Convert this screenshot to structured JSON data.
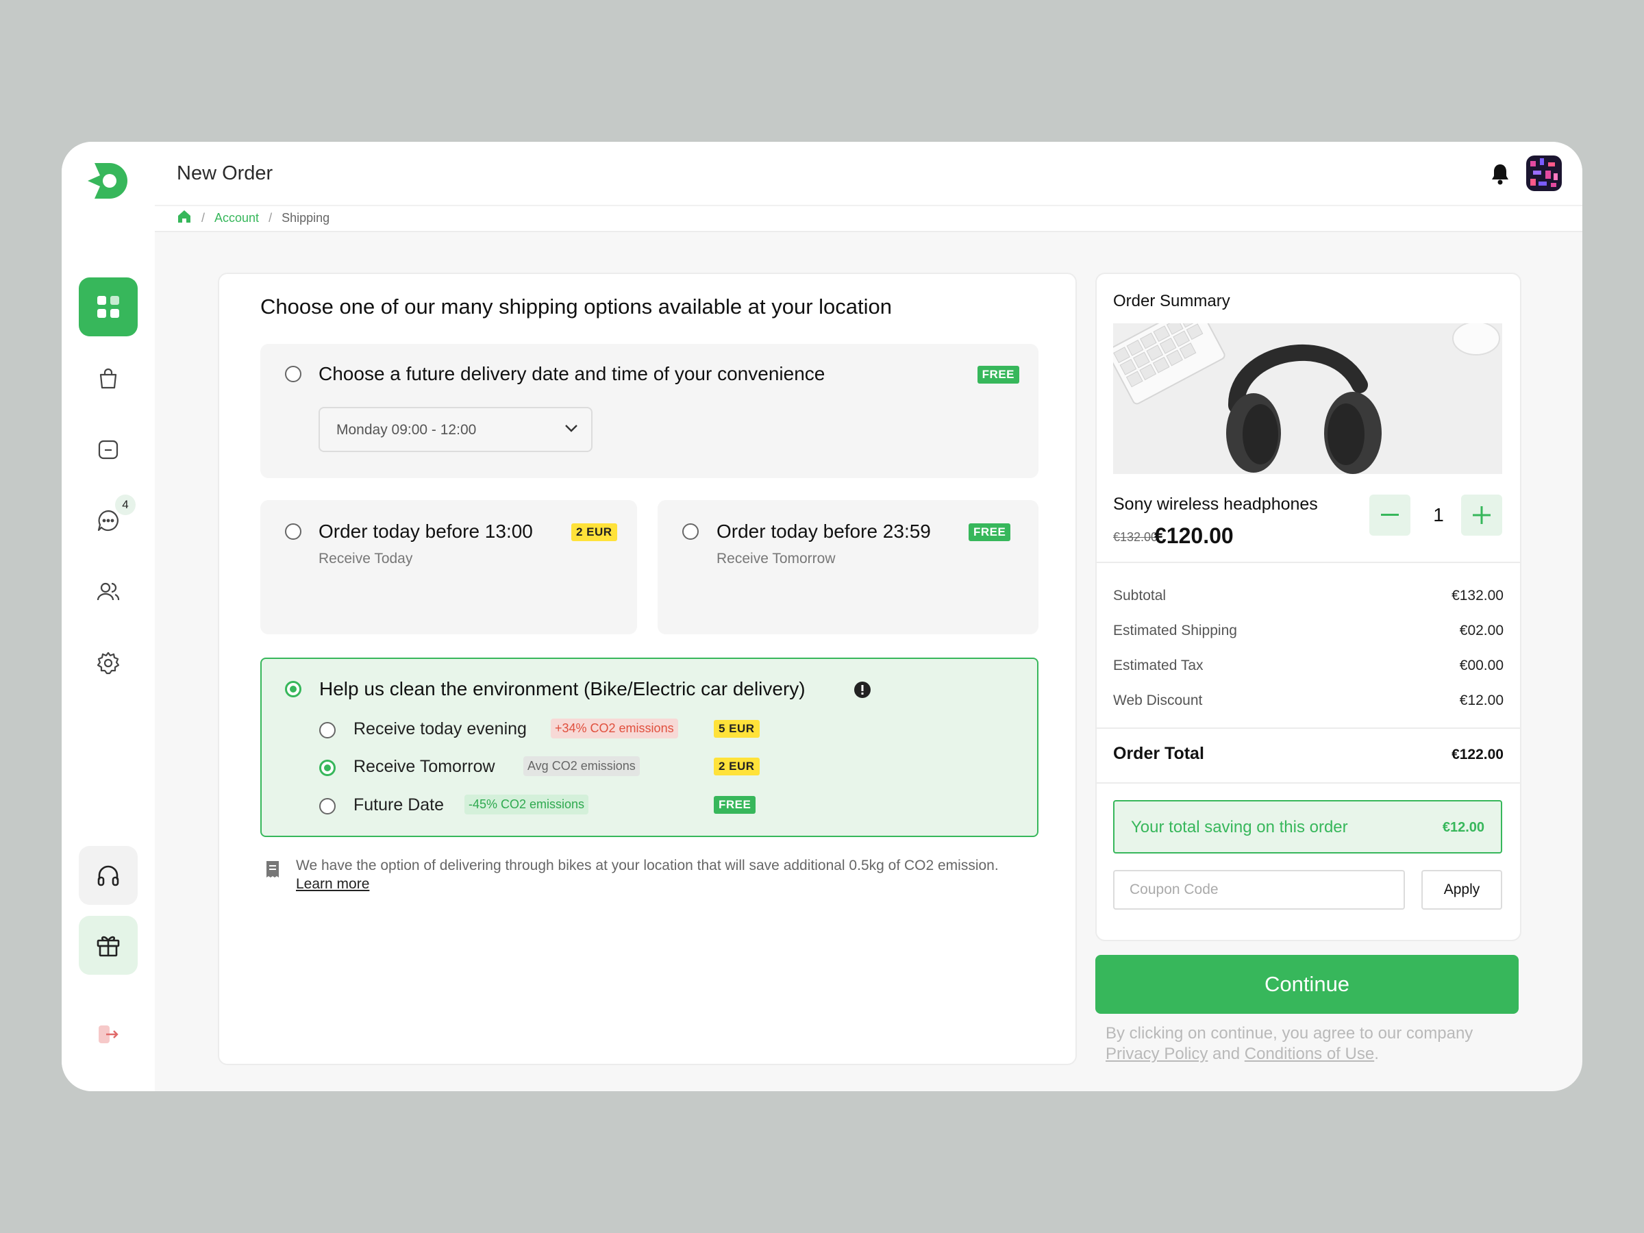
{
  "header": {
    "title": "New Order"
  },
  "breadcrumb": {
    "home_icon": "home-icon",
    "account": "Account",
    "current": "Shipping",
    "separator": "/"
  },
  "sidebar": {
    "items": [
      {
        "name": "dashboard",
        "icon": "grid-icon",
        "active": true
      },
      {
        "name": "shop",
        "icon": "shopping-bag-icon"
      },
      {
        "name": "documents",
        "icon": "folder-icon"
      },
      {
        "name": "messages",
        "icon": "chat-icon",
        "badge": "4"
      },
      {
        "name": "users",
        "icon": "users-icon"
      },
      {
        "name": "settings",
        "icon": "gear-icon"
      },
      {
        "name": "support",
        "icon": "headphones-icon"
      },
      {
        "name": "gifts",
        "icon": "gift-icon"
      },
      {
        "name": "logout",
        "icon": "logout-icon"
      }
    ]
  },
  "shipping": {
    "heading": "Choose one of our many shipping options available at your location",
    "future": {
      "title": "Choose a future delivery date and time of your convenience",
      "tag": "FREE",
      "select_value": "Monday 09:00 - 12:00"
    },
    "today": {
      "title": "Order today before 13:00",
      "subtitle": "Receive Today",
      "tag": "2 EUR"
    },
    "tomorrow": {
      "title": "Order today before 23:59",
      "subtitle": "Receive Tomorrow",
      "tag": "FREE"
    },
    "eco": {
      "title": "Help us clean the environment (Bike/Electric car delivery)",
      "options": [
        {
          "label": "Receive today evening",
          "co2": "+34% CO2 emissions",
          "tag": "5 EUR",
          "selected": false
        },
        {
          "label": "Receive Tomorrow",
          "co2": "Avg CO2 emissions",
          "tag": "2 EUR",
          "selected": true
        },
        {
          "label": "Future Date",
          "co2": "-45% CO2 emissions",
          "tag": "FREE",
          "selected": false
        }
      ]
    },
    "note": {
      "text": "We have the option of delivering through bikes at your location that will save additional 0.5kg of CO2 emission.",
      "link": "Learn more"
    }
  },
  "summary": {
    "title": "Order Summary",
    "product": {
      "name": "Sony wireless headphones",
      "old_price": "€132.00",
      "price": "€120.00",
      "quantity": "1"
    },
    "rows": [
      {
        "label": "Subtotal",
        "value": "€132.00"
      },
      {
        "label": "Estimated Shipping",
        "value": "€02.00"
      },
      {
        "label": "Estimated Tax",
        "value": "€00.00"
      },
      {
        "label": "Web Discount",
        "value": "€12.00"
      }
    ],
    "total_label": "Order Total",
    "total_value": "€122.00",
    "saving_label": "Your total saving on this order",
    "saving_value": "€12.00",
    "coupon_placeholder": "Coupon Code",
    "apply_label": "Apply"
  },
  "cta": {
    "continue_label": "Continue",
    "legal_prefix": "By clicking on continue, you agree to our company",
    "privacy": "Privacy Policy",
    "and": "and",
    "conditions": "Conditions of Use",
    "period": "."
  },
  "colors": {
    "accent": "#37b75b",
    "eco_bg": "#e8f5ea",
    "tag_yellow": "#ffe23a"
  }
}
